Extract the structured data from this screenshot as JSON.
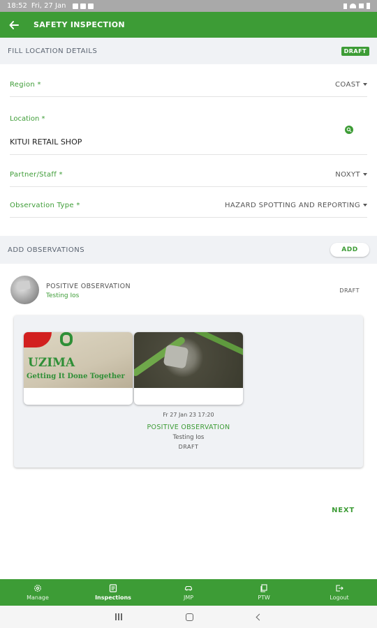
{
  "status_bar": {
    "time": "18:52",
    "date": "Fri, 27 Jan"
  },
  "app_bar": {
    "title": "SAFETY INSPECTION",
    "back_icon": "arrow-left-icon"
  },
  "location_section": {
    "header": "FILL LOCATION DETAILS",
    "badge": "DRAFT"
  },
  "form": {
    "region": {
      "label": "Region *",
      "value": "COAST"
    },
    "location": {
      "label": "Location *",
      "value": "KITUI RETAIL SHOP"
    },
    "partner": {
      "label": "Partner/Staff *",
      "value": "NOXYT"
    },
    "observation_type": {
      "label": "Observation Type *",
      "value": "HAZARD SPOTTING AND REPORTING"
    }
  },
  "observations_section": {
    "header": "ADD OBSERVATIONS",
    "add_label": "ADD"
  },
  "observation": {
    "title": "POSITIVE OBSERVATION",
    "subtitle": "Testing Ios",
    "status": "DRAFT"
  },
  "detail_card": {
    "image1_text": {
      "line1": "UZIMA",
      "line2": "Getting It Done Together"
    },
    "date": "Fr 27 Jan 23 17:20",
    "title": "POSITIVE OBSERVATION",
    "subtitle": "Testing Ios",
    "status": "DRAFT"
  },
  "next_label": "NEXT",
  "bottom_nav": [
    {
      "label": "Manage",
      "icon": "gear-icon"
    },
    {
      "label": "Inspections",
      "icon": "clipboard-icon",
      "active": true
    },
    {
      "label": "JMP",
      "icon": "car-icon"
    },
    {
      "label": "PTW",
      "icon": "documents-icon"
    },
    {
      "label": "Logout",
      "icon": "logout-icon"
    }
  ],
  "colors": {
    "primary": "#3d9c36",
    "section_bg": "#f0f2f5"
  }
}
